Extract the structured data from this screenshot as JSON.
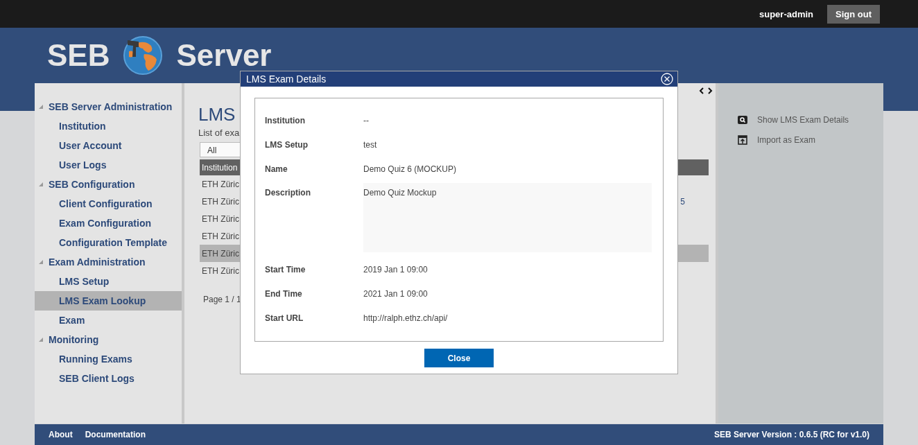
{
  "top_bar": {
    "user": "super-admin",
    "sign_out": "Sign out"
  },
  "header": {
    "logo_left": "SEB",
    "logo_right": "Server"
  },
  "sidebar": {
    "groups": [
      {
        "label": "SEB Server Administration",
        "expanded": true,
        "children": [
          {
            "label": "Institution",
            "selected": false
          },
          {
            "label": "User Account",
            "selected": false
          },
          {
            "label": "User Logs",
            "selected": false
          }
        ]
      },
      {
        "label": "SEB Configuration",
        "expanded": true,
        "children": [
          {
            "label": "Client Configuration",
            "selected": false
          },
          {
            "label": "Exam Configuration",
            "selected": false
          },
          {
            "label": "Configuration Template",
            "selected": false
          }
        ]
      },
      {
        "label": "Exam Administration",
        "expanded": true,
        "children": [
          {
            "label": "LMS Setup",
            "selected": false
          },
          {
            "label": "LMS Exam Lookup",
            "selected": true
          },
          {
            "label": "Exam",
            "selected": false
          }
        ]
      },
      {
        "label": "Monitoring",
        "expanded": true,
        "children": [
          {
            "label": "Running Exams",
            "selected": false
          },
          {
            "label": "SEB Client Logs",
            "selected": false
          }
        ]
      }
    ]
  },
  "content": {
    "title": "LMS",
    "subtitle": "List of exa",
    "filter": {
      "value": "All"
    },
    "table": {
      "columns": [
        "Institution"
      ],
      "rows": [
        {
          "cells": [
            "ETH Züric"
          ],
          "selected": false
        },
        {
          "cells": [
            "ETH Züric",
            "5"
          ],
          "selected": false
        },
        {
          "cells": [
            "ETH Züric"
          ],
          "selected": false
        },
        {
          "cells": [
            "ETH Züric"
          ],
          "selected": false
        },
        {
          "cells": [
            "ETH Züric"
          ],
          "selected": true
        },
        {
          "cells": [
            "ETH Züric"
          ],
          "selected": false
        }
      ]
    },
    "pagination": "Page 1 / 1"
  },
  "actions": [
    {
      "label": "Show LMS Exam Details",
      "kind": "show"
    },
    {
      "label": "Import as Exam",
      "kind": "import"
    }
  ],
  "dialog": {
    "title": "LMS Exam Details",
    "fields": [
      {
        "label": "Institution",
        "value": "--",
        "kind": "text"
      },
      {
        "label": "LMS Setup",
        "value": "test",
        "kind": "text"
      },
      {
        "label": "Name",
        "value": "Demo Quiz 6 (MOCKUP)",
        "kind": "text"
      },
      {
        "label": "Description",
        "value": "Demo Quiz Mockup",
        "kind": "textarea"
      },
      {
        "label": "Start Time",
        "value": "2019 Jan 1 09:00",
        "kind": "text"
      },
      {
        "label": "End Time",
        "value": "2021 Jan 1 09:00",
        "kind": "text"
      },
      {
        "label": "Start URL",
        "value": "http://ralph.ethz.ch/api/",
        "kind": "text"
      }
    ],
    "close": "Close"
  },
  "footer": {
    "links": [
      "About",
      "Documentation"
    ],
    "version": "SEB Server Version : 0.6.5 (RC for v1.0)"
  }
}
